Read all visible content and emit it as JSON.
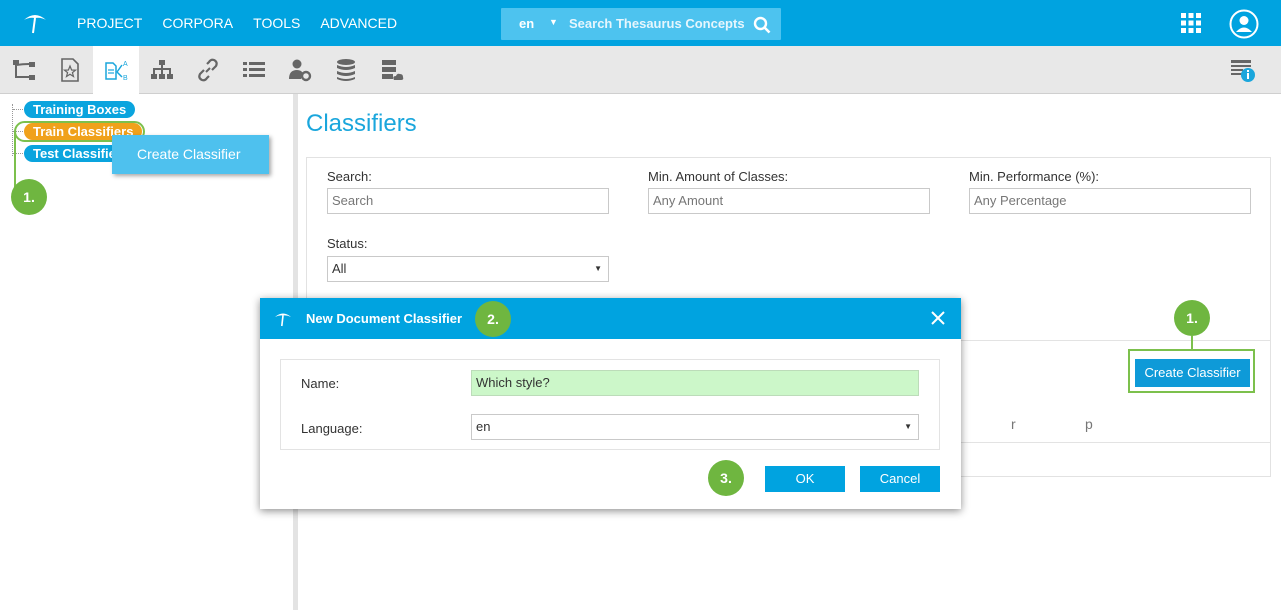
{
  "nav": {
    "menu": [
      "PROJECT",
      "CORPORA",
      "TOOLS",
      "ADVANCED"
    ],
    "search_lang": "en",
    "search_placeholder": "Search Thesaurus Concepts"
  },
  "tree": {
    "items": [
      "Training Boxes",
      "Train Classifiers",
      "Test Classifier"
    ],
    "context_menu_item": "Create Classifier"
  },
  "main": {
    "title": "Classifiers",
    "filters": {
      "search_label": "Search:",
      "search_placeholder": "Search",
      "min_classes_label": "Min. Amount of Classes:",
      "min_classes_placeholder": "Any Amount",
      "min_perf_label": "Min. Performance (%):",
      "min_perf_placeholder": "Any Percentage",
      "status_label": "Status:",
      "status_value": "All"
    },
    "create_button": "Create Classifier",
    "columns": [
      "r",
      "p"
    ]
  },
  "dialog": {
    "title": "New Document Classifier",
    "name_label": "Name:",
    "name_value": "Which style?",
    "language_label": "Language:",
    "language_value": "en",
    "ok_button": "OK",
    "cancel_button": "Cancel"
  },
  "annotations": {
    "step1_tree": "1.",
    "step1_main": "1.",
    "step2": "2.",
    "step3": "3."
  },
  "colors": {
    "primary": "#00a3e0",
    "annotation_green": "#6fb640",
    "active_pill": "#f0a11b",
    "name_input_bg": "#ccf7c9"
  }
}
